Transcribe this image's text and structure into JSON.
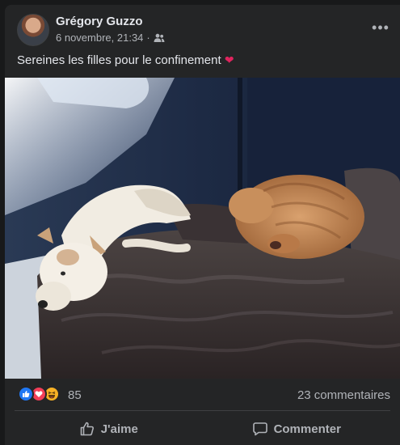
{
  "post": {
    "author": "Grégory Guzzo",
    "timestamp": "6 novembre, 21:34",
    "separator": "·",
    "audience_icon": "friends-icon",
    "more_icon": "more-horizontal-icon",
    "more_label": "•••",
    "caption": "Sereines les filles pour le confinement",
    "caption_emoji": "❤"
  },
  "reactions": {
    "icons": [
      "like-icon",
      "love-icon",
      "haha-icon"
    ],
    "count": "85",
    "comments": "23 commentaires"
  },
  "actions": {
    "like_label": "J'aime",
    "comment_label": "Commenter"
  },
  "colors": {
    "card_bg": "#242526",
    "text_primary": "#e4e6eb",
    "text_secondary": "#b0b3b8",
    "like_blue": "#2078f4",
    "love_red": "#f33e58",
    "haha_yellow": "#f7b125"
  }
}
